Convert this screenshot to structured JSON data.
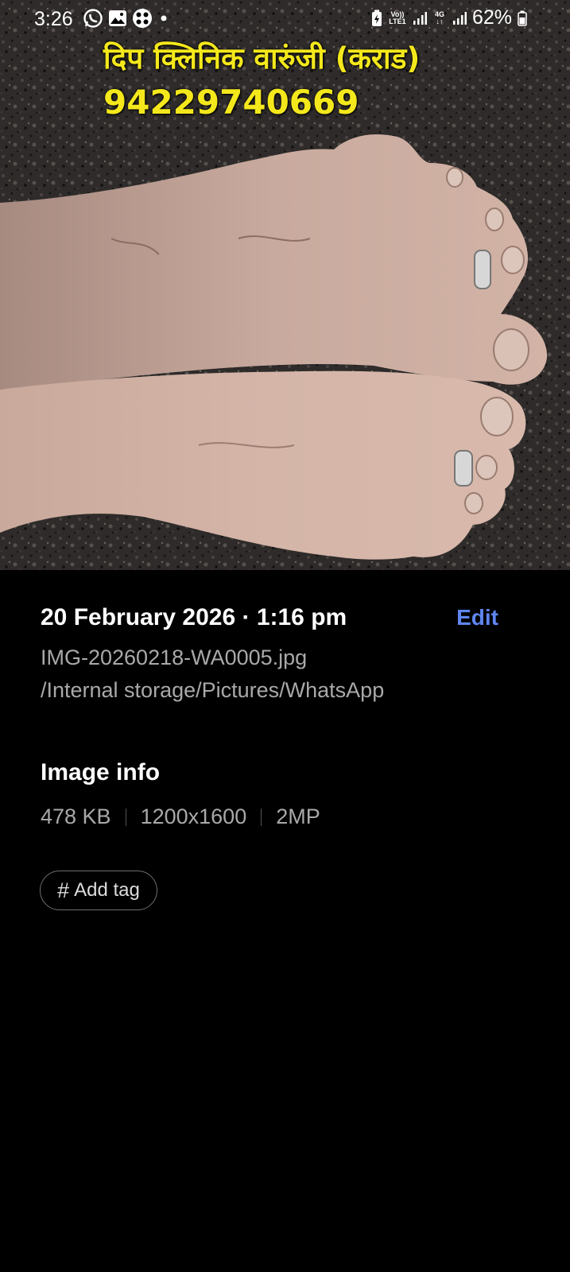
{
  "status_bar": {
    "time": "3:26",
    "left_icons": [
      "whatsapp-icon",
      "gallery-icon",
      "game-icon",
      "dot-icon"
    ],
    "volte_label": "Vo)) LTE1",
    "network_label": "4G",
    "battery_percent": "62%"
  },
  "photo": {
    "overlay_title": "दिप क्लिनिक वारुंजी (कराड)",
    "overlay_phone": "94229740669"
  },
  "details": {
    "date": "20 February 2026 · 1:16 pm",
    "edit_label": "Edit",
    "filename": "IMG-20260218-WA0005.jpg",
    "path": "/Internal storage/Pictures/WhatsApp"
  },
  "image_info": {
    "title": "Image info",
    "size": "478 KB",
    "resolution": "1200x1600",
    "megapixels": "2MP"
  },
  "tag": {
    "icon": "#",
    "label": "Add tag"
  },
  "colors": {
    "accent": "#5f86f0",
    "overlay_text": "#f4e81c",
    "secondary_text": "#a9a9a9",
    "background": "#000000"
  }
}
